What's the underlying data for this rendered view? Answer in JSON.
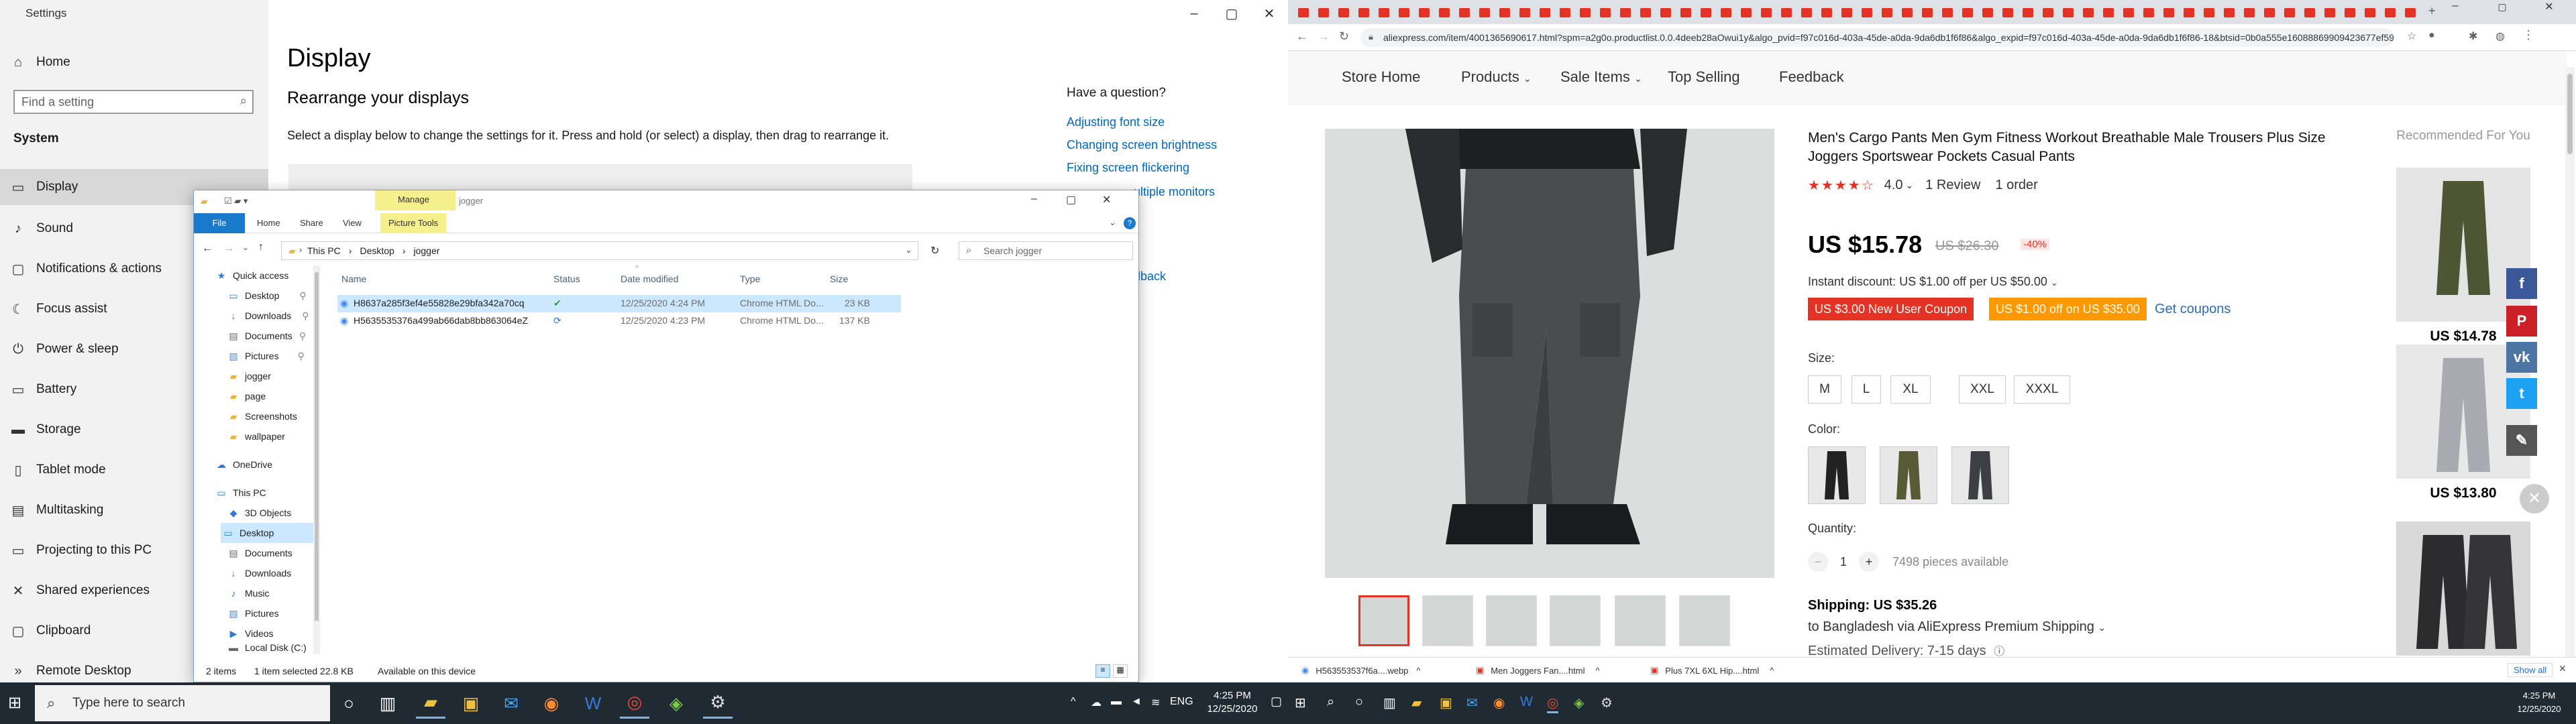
{
  "settings": {
    "title": "Settings",
    "home": "Home",
    "search_placeholder": "Find a setting",
    "section": "System",
    "nav": [
      "Display",
      "Sound",
      "Notifications & actions",
      "Focus assist",
      "Power & sleep",
      "Battery",
      "Storage",
      "Tablet mode",
      "Multitasking",
      "Projecting to this PC",
      "Shared experiences",
      "Clipboard",
      "Remote Desktop"
    ],
    "page_title": "Display",
    "subtitle": "Rearrange your displays",
    "description": "Select a display below to change the settings for it. Press and hold (or select) a display, then drag to rearrange it.",
    "question_title": "Have a question?",
    "links": [
      "Adjusting font size",
      "Changing screen brightness",
      "Fixing screen flickering",
      "ultiple monitors",
      "dback"
    ]
  },
  "explorer": {
    "title": "jogger",
    "manage": "Manage",
    "tabs": [
      "File",
      "Home",
      "Share",
      "View",
      "Picture Tools"
    ],
    "breadcrumb": [
      "This PC",
      "Desktop",
      "jogger"
    ],
    "search_placeholder": "Search jogger",
    "nav": [
      "Quick access",
      "Desktop",
      "Downloads",
      "Documents",
      "Pictures",
      "jogger",
      "page",
      "Screenshots",
      "wallpaper",
      "OneDrive",
      "This PC",
      "3D Objects",
      "Desktop",
      "Documents",
      "Downloads",
      "Music",
      "Pictures",
      "Videos",
      "Local Disk (C:)"
    ],
    "columns": [
      "Name",
      "Status",
      "Date modified",
      "Type",
      "Size"
    ],
    "files": [
      {
        "name": "H8637a285f3ef4e55828e29bfa342a70cq",
        "date": "12/25/2020 4:24 PM",
        "type": "Chrome HTML Do...",
        "size": "23 KB"
      },
      {
        "name": "H5635535376a499ab66dab8bb863064eZ",
        "date": "12/25/2020 4:23 PM",
        "type": "Chrome HTML Do...",
        "size": "137 KB"
      }
    ],
    "status": {
      "items": "2 items",
      "selected": "1 item selected  22.8 KB",
      "available": "Available on this device"
    }
  },
  "taskbar": {
    "search": "Type here to search",
    "time": "4:25 PM",
    "date": "12/25/2020"
  },
  "chrome": {
    "url": "aliexpress.com/item/4001365690617.html?spm=a2g0o.productlist.0.0.4deeb28aOwui1y&algo_pvid=f97c016d-403a-45de-a0da-9da6db1f6f86&algo_expid=f97c016d-403a-45de-a0da-9da6db1f6f86-18&btsid=0b0a555e16088869909423677ef59&ws_ab...",
    "store_nav": [
      "Store Home",
      "Products",
      "Sale Items",
      "Top Selling",
      "Feedback"
    ],
    "product_title": "Men's Cargo Pants Men Gym Fitness Workout Breathable Male Trousers Plus Size Joggers Sportswear Pockets Casual Pants",
    "rating": "4.0",
    "reviews": "1 Review",
    "orders": "1 order",
    "price": "US $15.78",
    "old_price": "US $26.30",
    "discount": "-40%",
    "instant_discount": "Instant discount: US $1.00 off per US $50.00",
    "coupon_new": "US $3.00 New User Coupon",
    "coupon_off": "US $1.00 off on US $35.00",
    "get_coupons": "Get coupons",
    "size_label": "Size:",
    "sizes": [
      "M",
      "L",
      "XL",
      "XXL",
      "XXXL"
    ],
    "color_label": "Color:",
    "quantity_label": "Quantity:",
    "quantity": "1",
    "available": "7498 pieces available",
    "shipping": "Shipping: US $35.26",
    "shipping_to": "to Bangladesh via AliExpress Premium Shipping",
    "delivery": "Estimated Delivery: 7-15 days",
    "recommended": "Recommended For You",
    "rec_prices": [
      "US $14.78",
      "US $13.80"
    ],
    "downloads": [
      "H563553537f6a....webp",
      "Men Joggers Fan....html",
      "Plus 7XL 6XL Hip....html"
    ],
    "show_all": "Show all",
    "accent": "#e43225",
    "coupon_orange": "#ff9900"
  }
}
